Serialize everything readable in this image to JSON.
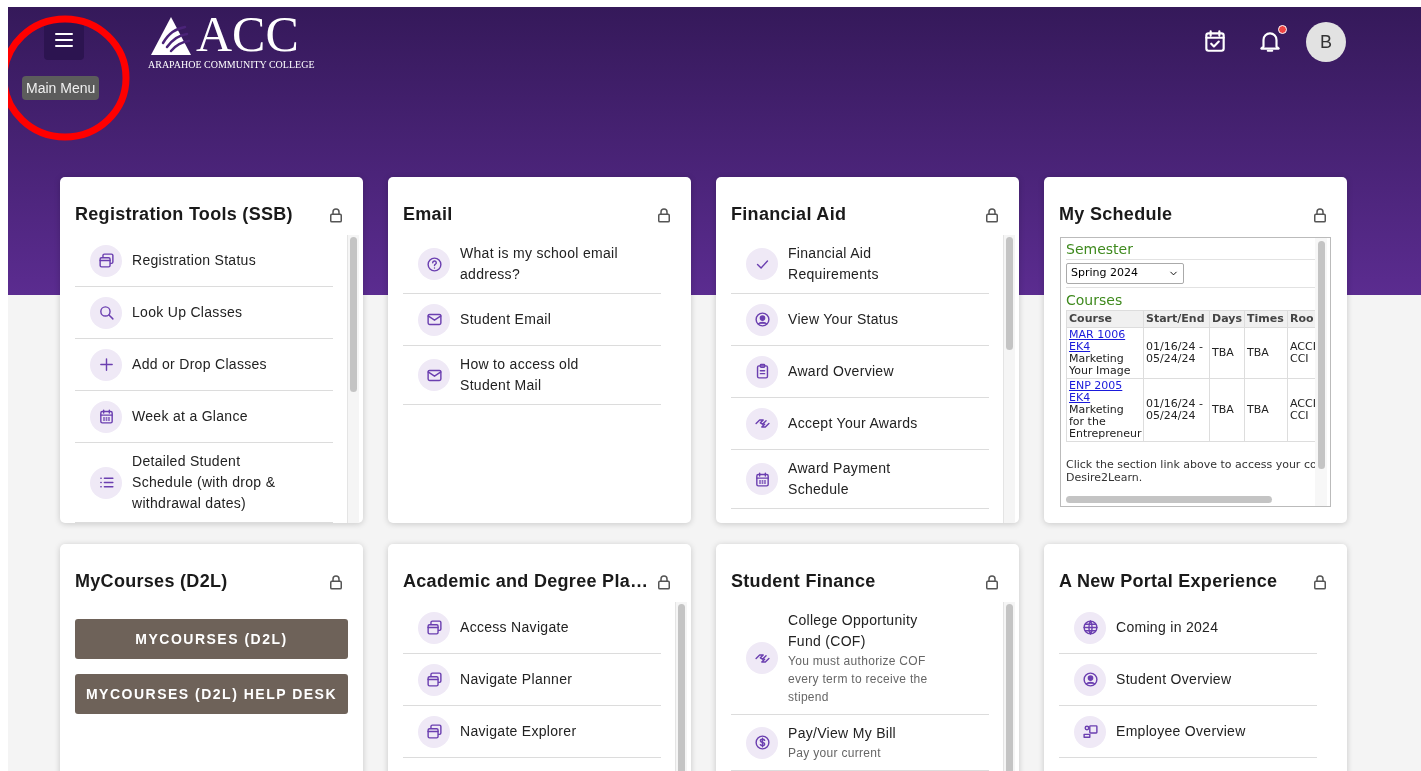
{
  "header": {
    "logo_text": "ACC",
    "logo_subtitle": "ARAPAHOE COMMUNITY COLLEGE",
    "menu_tooltip": "Main Menu",
    "notifications_unread": true,
    "avatar_initial": "B"
  },
  "annotation": {
    "kind": "circle",
    "color": "#ff0000"
  },
  "cards": [
    {
      "title": "Registration Tools (SSB)",
      "kind": "list",
      "items": [
        {
          "label": "Registration Status"
        },
        {
          "label": "Look Up Classes"
        },
        {
          "label": "Add or Drop Classes"
        },
        {
          "label": "Week at a Glance"
        },
        {
          "label": "Detailed Student Schedule (with drop & withdrawal dates)"
        }
      ]
    },
    {
      "title": "Email",
      "kind": "list",
      "items": [
        {
          "label": "What is my school email address?"
        },
        {
          "label": "Student Email"
        },
        {
          "label": "How to access old Student Mail"
        }
      ]
    },
    {
      "title": "Financial Aid",
      "kind": "list",
      "items": [
        {
          "label": "Financial Aid Requirements"
        },
        {
          "label": "View Your Status"
        },
        {
          "label": "Award Overview"
        },
        {
          "label": "Accept Your Awards"
        },
        {
          "label": "Award Payment Schedule"
        }
      ]
    },
    {
      "title": "My Schedule",
      "kind": "schedule",
      "semester_heading": "Semester",
      "semester": "Spring 2024",
      "courses_heading": "Courses",
      "columns": [
        "Course",
        "Start/End",
        "Days",
        "Times",
        "Roo"
      ],
      "rows": [
        {
          "course": "MAR 1006 EK4",
          "course_title": "Marketing Your Image",
          "start_end": "01/16/24 - 05/24/24",
          "days": "TBA",
          "times": "TBA",
          "room": "ACCI CCI"
        },
        {
          "course": "ENP 2005 EK4",
          "course_title": "Marketing for the Entrepreneur",
          "start_end": "01/16/24 - 05/24/24",
          "days": "TBA",
          "times": "TBA",
          "room": "ACCI CCI"
        }
      ],
      "note_lines": [
        "Click the section link above to access your co",
        "Desire2Learn."
      ]
    },
    {
      "title": "MyCourses (D2L)",
      "kind": "buttons",
      "buttons": [
        "MYCOURSES (D2L)",
        "MYCOURSES (D2L) HELP DESK"
      ]
    },
    {
      "title": "Academic and Degree Pla…",
      "kind": "list",
      "items": [
        {
          "label": "Access Navigate"
        },
        {
          "label": "Navigate Planner"
        },
        {
          "label": "Navigate Explorer"
        }
      ]
    },
    {
      "title": "Student Finance",
      "kind": "list",
      "items": [
        {
          "label": "College Opportunity Fund (COF)",
          "sublabel": "You must authorize COF every term to receive the stipend"
        },
        {
          "label": "Pay/View My Bill",
          "sublabel": "Pay your current"
        }
      ]
    },
    {
      "title": "A New Portal Experience",
      "kind": "list",
      "items": [
        {
          "label": "Coming in 2024"
        },
        {
          "label": "Student Overview"
        },
        {
          "label": "Employee Overview"
        }
      ]
    }
  ]
}
